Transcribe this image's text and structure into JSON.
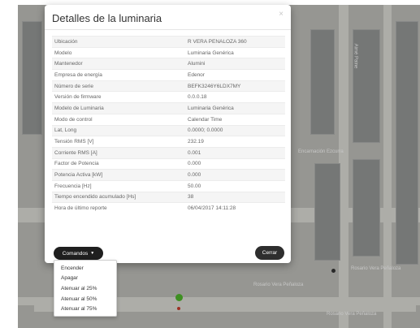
{
  "modal": {
    "title": "Detalles de la luminaria",
    "close_glyph": "×",
    "rows": [
      {
        "label": "Ubicación",
        "value": "R VERA PENALOZA 360"
      },
      {
        "label": "Modelo",
        "value": "Luminaria Genérica"
      },
      {
        "label": "Mantenedor",
        "value": "Alumini"
      },
      {
        "label": "Empresa de energía",
        "value": "Edenor"
      },
      {
        "label": "Número de serie",
        "value": "BEFK3246Y6LDX7MY"
      },
      {
        "label": "Versión de firmware",
        "value": "0.0.0.18"
      },
      {
        "label": "Modelo de Luminaria",
        "value": "Luminaria Genérica"
      },
      {
        "label": "Modo de control",
        "value": "Calendar Time"
      },
      {
        "label": "Lat, Long",
        "value": "0.0000; 0.0000"
      },
      {
        "label": "Tensión RMS [V]",
        "value": "232.19"
      },
      {
        "label": "Corriente RMS [A]",
        "value": "0.001"
      },
      {
        "label": "Factor de Potencia",
        "value": "0.000"
      },
      {
        "label": "Potencia Activa [kW]",
        "value": "0.000"
      },
      {
        "label": "Frecuencia [Hz]",
        "value": "50.00"
      },
      {
        "label": "Tiempo encendido acumulado [Hs]",
        "value": "38"
      },
      {
        "label": "Hora de último reporte",
        "value": "06/04/2017 14:11:28"
      }
    ],
    "commands_label": "Comandos",
    "close_label": "Cerrar"
  },
  "dropdown": {
    "items": [
      "Encender",
      "Apagar",
      "Atenuar al 25%",
      "Atenuar al 50%",
      "Atenuar al 75%"
    ]
  },
  "map": {
    "street_labels": [
      "Encarnación Ezcurra",
      "Aimé Paine",
      "Rosario Vera Peñaloza",
      "Rosario Vera Peñaloza",
      "Rosario Vera Peñaloza"
    ]
  },
  "colors": {
    "marker_green": "#4caf2a",
    "marker_red": "#c0392b",
    "button_dark": "#1f1f1f"
  }
}
